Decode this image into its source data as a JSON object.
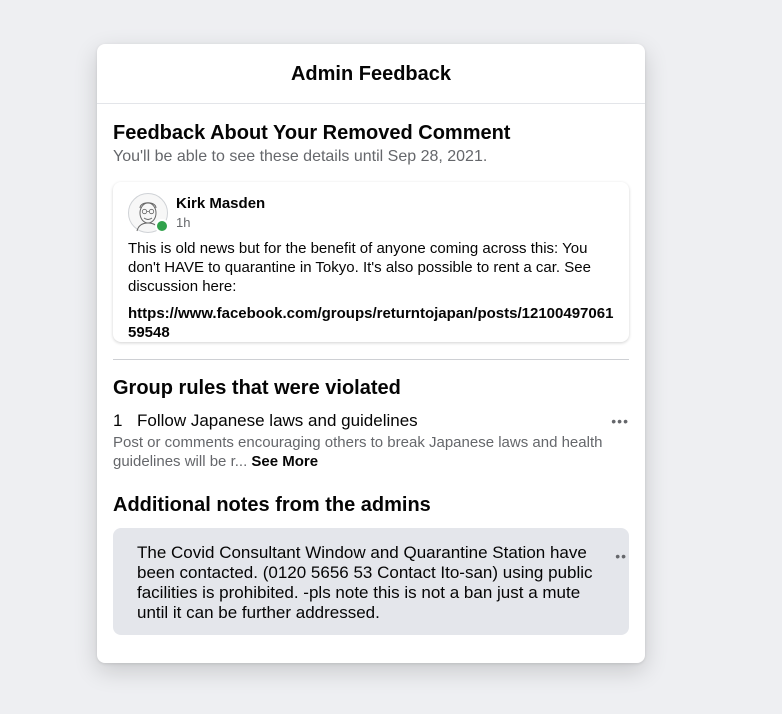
{
  "modal": {
    "title": "Admin Feedback"
  },
  "feedback": {
    "heading": "Feedback About Your Removed Comment",
    "subtitle": "You'll be able to see these details until Sep 28, 2021."
  },
  "comment": {
    "author": "Kirk Masden",
    "time": "1h",
    "text": "This is old news but for the benefit of anyone coming across this: You don't HAVE to quarantine in Tokyo.  It's also possible to rent a car. See discussion here:",
    "link": "https://www.facebook.com/groups/returntojapan/posts/1210049706159548",
    "online_color": "#31a24c"
  },
  "rules": {
    "heading": "Group rules that were violated",
    "items": [
      {
        "number": "1",
        "title": "Follow Japanese laws and guidelines",
        "description": "Post or comments encouraging others to break Japanese laws and health guidelines will be r...",
        "see_more": "See More",
        "more_icon": "ellipsis-icon"
      }
    ]
  },
  "notes": {
    "heading": "Additional notes from the admins",
    "text": "The Covid Consultant Window and Quarantine Station have been contacted. (0120 5656 53 Contact Ito-san) using public facilities is prohibited. -pls note this is not a ban just a mute until it can be further addressed.",
    "more_icon": "ellipsis-icon"
  }
}
